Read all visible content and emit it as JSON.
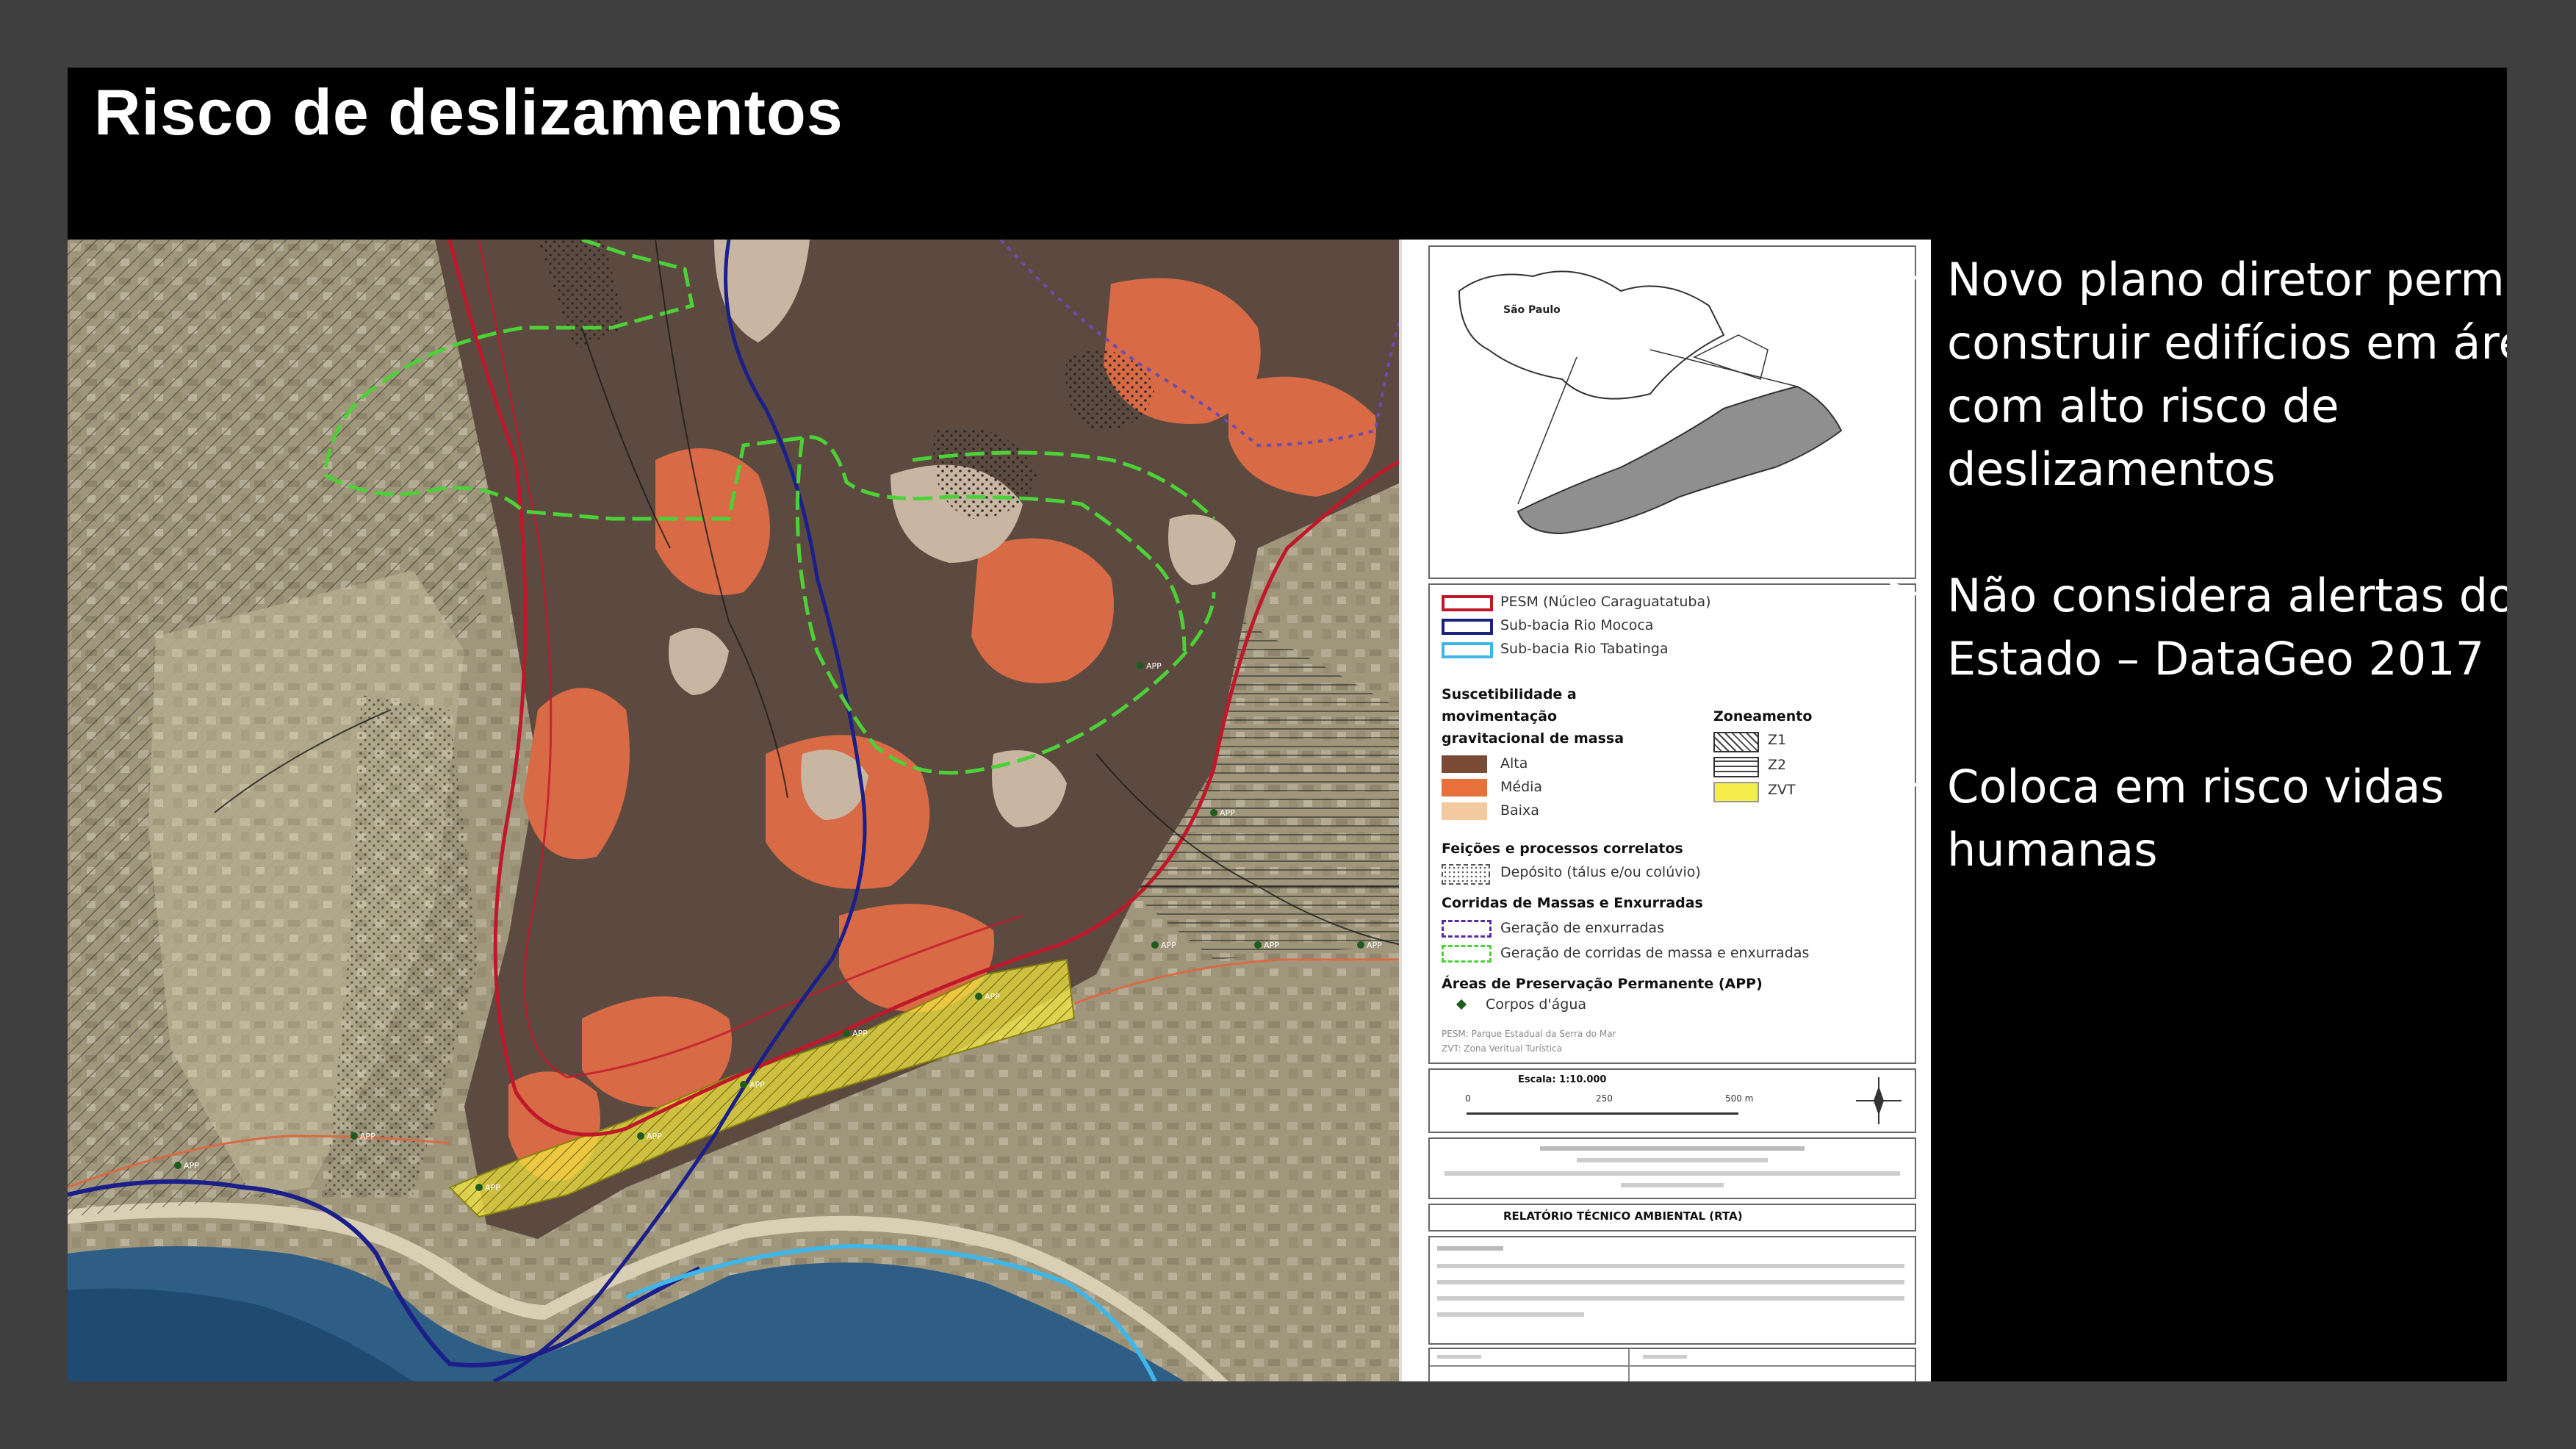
{
  "slide": {
    "title": "Risco de deslizamentos"
  },
  "bullets": [
    {
      "lines": [
        "Novo plano diretor  permit",
        "construir edifícios em área",
        "com alto risco de",
        "deslizamentos"
      ]
    },
    {
      "lines": [
        "Não considera alertas do",
        "Estado – DataGeo 2017"
      ]
    },
    {
      "lines": [
        "Coloca em risco vidas",
        "humanas"
      ]
    }
  ],
  "inset_map": {
    "label_state": "São Paulo"
  },
  "legend": {
    "boundaries": [
      {
        "label": "PESM (Núcleo Caraguatatuba)",
        "color": "#c0182a"
      },
      {
        "label": "Sub-bacia Rio Mococa",
        "color": "#1a237e"
      },
      {
        "label": "Sub-bacia Rio Tabatinga",
        "color": "#3fb6e8"
      }
    ],
    "susceptibility_title": [
      "Suscetibilidade a",
      "movimentação",
      "gravitacional de massa"
    ],
    "susceptibility": [
      {
        "label": "Alta",
        "color": "#7a4a35"
      },
      {
        "label": "Média",
        "color": "#e8703a"
      },
      {
        "label": "Baixa",
        "color": "#f3c9a0"
      }
    ],
    "zoning_title": "Zoneamento",
    "zoning": [
      {
        "label": "Z1"
      },
      {
        "label": "Z2"
      },
      {
        "label": "ZVT",
        "color": "#f5ee4a"
      }
    ],
    "features_title": "Feições e processos correlatos",
    "features_item": "Depósito (tálus e/ou colúvio)",
    "flows_title": "Corridas de Massas e Enxurradas",
    "flows": [
      {
        "label": "Geração de enxurradas",
        "color": "#5b2ca0"
      },
      {
        "label": "Geração de corridas de massa e enxurradas",
        "color": "#4cd137"
      }
    ],
    "app_title": "Áreas de Preservação Permanente (APP)",
    "app_item": "Corpos d'água",
    "abbreviations": [
      "PESM: Parque Estadual da Serra do Mar",
      "ZVT: Zona Veritual Turística"
    ],
    "scale_title": "Escala: 1:10.000",
    "scale_ticks": [
      "0",
      "250",
      "500 m"
    ],
    "report_title": "RELATÓRIO TÉCNICO AMBIENTAL (RTA)"
  },
  "map": {
    "app_tag": "APP"
  },
  "colors": {
    "high": "#5c4a40",
    "medium": "#d86a45",
    "low": "#c8b6a2",
    "zvt": "#f2e640",
    "boundary_red": "#c0182a",
    "river_blue": "#1a1f8a",
    "coast_cyan": "#3fb6e8",
    "flow_green": "#4cd137"
  }
}
